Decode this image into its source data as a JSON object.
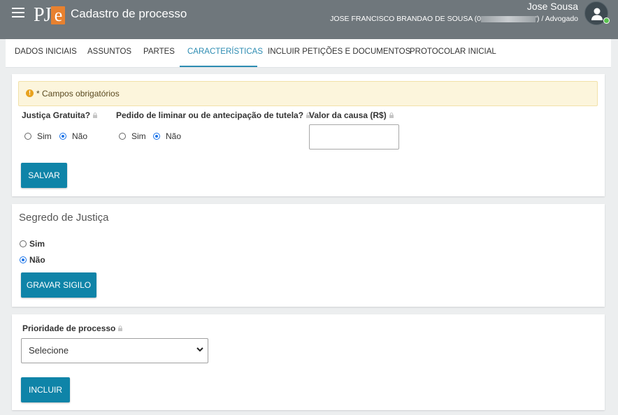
{
  "header": {
    "app_title": "Cadastro de processo",
    "user_name": "Jose Sousa",
    "user_detail_prefix": "JOSE FRANCISCO BRANDAO DE SOUSA (0",
    "user_detail_suffix": "') / Advogado",
    "logo_text": "PJ",
    "logo_e": "e"
  },
  "tabs": [
    {
      "label": "DADOS INICIAIS"
    },
    {
      "label": "ASSUNTOS"
    },
    {
      "label": "PARTES"
    },
    {
      "label": "CARACTERÍSTICAS",
      "active": true
    },
    {
      "label": "INCLUIR PETIÇÕES E DOCUMENTOS"
    },
    {
      "label": "PROTOCOLAR INICIAL"
    }
  ],
  "characteristics": {
    "alert_text": "* Campos obrigatórios",
    "justica_gratuita": {
      "label": "Justiça Gratuita?",
      "options": [
        "Sim",
        "Não"
      ],
      "selected": "Não"
    },
    "pedido_liminar": {
      "label": "Pedido de liminar ou de antecipação de tutela?",
      "options": [
        "Sim",
        "Não"
      ],
      "selected": "Não"
    },
    "valor_causa": {
      "label": "Valor da causa (R$)",
      "value": ""
    },
    "save_button": "SALVAR"
  },
  "segredo": {
    "title": "Segredo de Justiça",
    "options": [
      "Sim",
      "Não"
    ],
    "selected": "Não",
    "button": "GRAVAR SIGILO"
  },
  "prioridade": {
    "label": "Prioridade de processo",
    "selected": "Selecione",
    "button": "INCLUIR"
  },
  "colors": {
    "topbar": "#6f777c",
    "accent": "#0f84a8",
    "active_tab": "#2d8cb2",
    "alert_bg": "#fcf5dc",
    "logo_orange": "#e8812f",
    "online": "#58c14e"
  },
  "icons": [
    "menu-icon",
    "lock-icon",
    "warning-icon",
    "user-icon",
    "chevron-down-icon"
  ]
}
